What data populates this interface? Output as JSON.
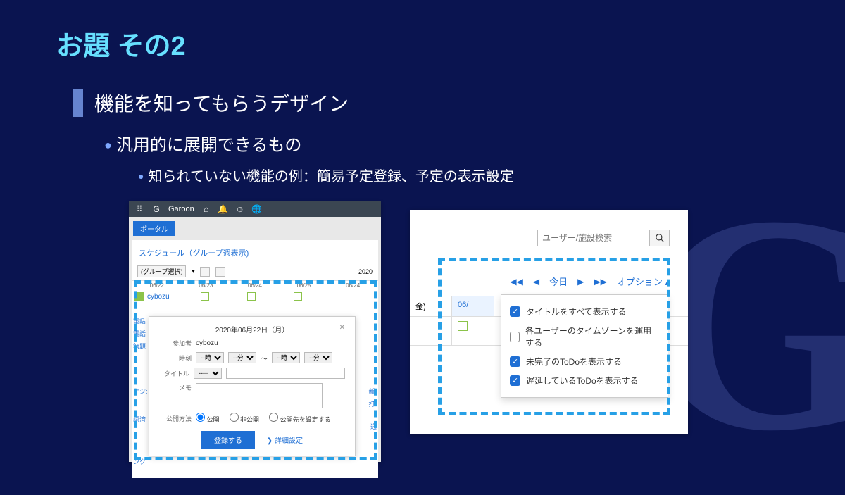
{
  "slide": {
    "title": "お題 その2",
    "subtitle": "機能を知ってもらうデザイン",
    "bullet1": "汎用的に展開できるもの",
    "bullet2": "知られていない機能の例：簡易予定登録、予定の表示設定"
  },
  "shot1": {
    "brand": "Garoon",
    "portal": "ポータル",
    "schedule_header": "スケジュール（グループ週表示)",
    "group_dropdown": "(グループ選択)",
    "year_label": "2020",
    "dates": [
      "06/22",
      "06/23",
      "06/24",
      "06/25",
      "06/24"
    ],
    "user": "cybozu",
    "left_labels": [
      "電話",
      "電話",
      "無題",
      "ケジ:",
      "認済",
      "ンク"
    ],
    "right_labels": [
      "新t",
      "打:",
      "通"
    ],
    "popup": {
      "date": "2020年06月22日（月）",
      "participant_label": "参加者",
      "participant": "cybozu",
      "time_label": "時刻",
      "hour_opt": "--時",
      "min_opt": "--分",
      "tilde": "～",
      "title_label": "タイトル",
      "title_sel": "-----",
      "memo_label": "メモ",
      "publish_label": "公開方法",
      "opt_public": "公開",
      "opt_private": "非公開",
      "opt_select": "公開先を設定する",
      "submit": "登録する",
      "detail": "詳細設定"
    }
  },
  "shot2": {
    "search_placeholder": "ユーザー/施設検索",
    "today": "今日",
    "options": "オプション",
    "row_label": "金)",
    "date": "06/",
    "menu": [
      {
        "label": "タイトルをすべて表示する",
        "checked": true
      },
      {
        "label": "各ユーザーのタイムゾーンを運用する",
        "checked": false
      },
      {
        "label": "未完了のToDoを表示する",
        "checked": true
      },
      {
        "label": "遅延しているToDoを表示する",
        "checked": true
      }
    ]
  }
}
